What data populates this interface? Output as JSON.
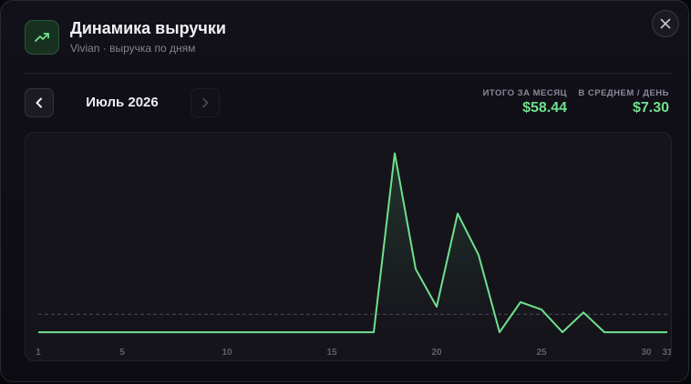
{
  "header": {
    "icon": "trending-up-icon",
    "title": "Динамика выручки",
    "subtitle": "Vivian · выручка по дням"
  },
  "close_icon": "close-icon",
  "period": {
    "label": "Июль 2026",
    "prev_icon": "chevron-left-icon",
    "next_icon": "chevron-right-icon"
  },
  "stats": {
    "total_label": "ИТОГО ЗА МЕСЯЦ",
    "total_value": "$58.44",
    "avg_label": "В СРЕДНЕМ / ДЕНЬ",
    "avg_value": "$7.30"
  },
  "colors": {
    "accent": "#6fe08d",
    "background": "#121019"
  },
  "chart_data": {
    "type": "area",
    "x": [
      1,
      2,
      3,
      4,
      5,
      6,
      7,
      8,
      9,
      10,
      11,
      12,
      13,
      14,
      15,
      16,
      17,
      18,
      19,
      20,
      21,
      22,
      23,
      24,
      25,
      26,
      27,
      28,
      29,
      30,
      31
    ],
    "values": [
      0,
      0,
      0,
      0,
      0,
      0,
      0,
      0,
      0,
      0,
      0,
      0,
      0,
      0,
      0,
      0,
      0,
      19.0,
      6.7,
      2.7,
      12.6,
      8.2,
      0,
      3.2,
      2.4,
      0,
      2.1,
      0,
      0,
      0,
      0
    ],
    "tick_labels": [
      "1",
      "5",
      "10",
      "15",
      "20",
      "25",
      "30",
      "31"
    ],
    "tick_positions": [
      1,
      5,
      10,
      15,
      20,
      25,
      30,
      31
    ],
    "reference_line": 1.9,
    "ylim": [
      -1.25,
      20.4
    ],
    "grid": false,
    "title": "",
    "xlabel": "",
    "ylabel": ""
  }
}
